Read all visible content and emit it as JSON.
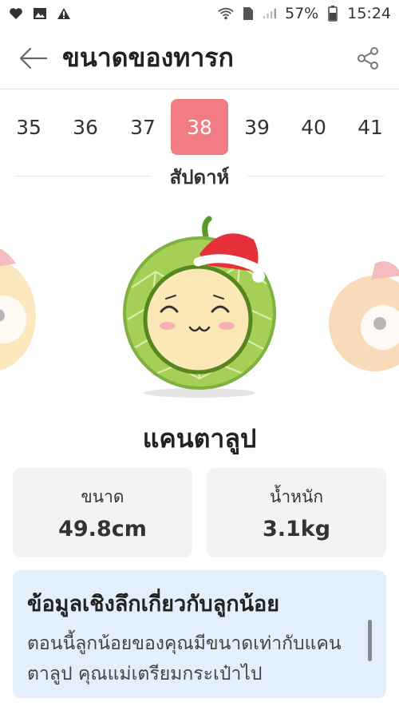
{
  "status": {
    "battery": "57%",
    "time": "15:24",
    "icons": [
      "heart-icon",
      "image-icon",
      "warning-icon",
      "wifi-icon",
      "sim-icon",
      "signal-icon",
      "battery-icon"
    ]
  },
  "appbar": {
    "title": "ขนาดของทารก",
    "back_icon": "arrow-left-icon",
    "share_icon": "share-icon"
  },
  "weeks": {
    "items": [
      "35",
      "36",
      "37",
      "38",
      "39",
      "40",
      "41"
    ],
    "selected": "38",
    "label": "สัปดาห์"
  },
  "fruit": {
    "name": "แคนตาลูป",
    "illustration": "cantaloupe-with-santa-hat"
  },
  "stats": {
    "size_label": "ขนาด",
    "size_value": "49.8cm",
    "weight_label": "น้ำหนัก",
    "weight_value": "3.1kg"
  },
  "insight": {
    "title": "ข้อมูลเชิงลึกเกี่ยวกับลูกน้อย",
    "body": "ตอนนี้ลูกน้อยของคุณมีขนาดเท่ากับแคนตาลูป คุณแม่เตรียมกระเป๋าไป"
  },
  "colors": {
    "accent": "#f27c84",
    "card_bg": "#f3f3f4",
    "insight_bg": "#e3f0fb"
  }
}
